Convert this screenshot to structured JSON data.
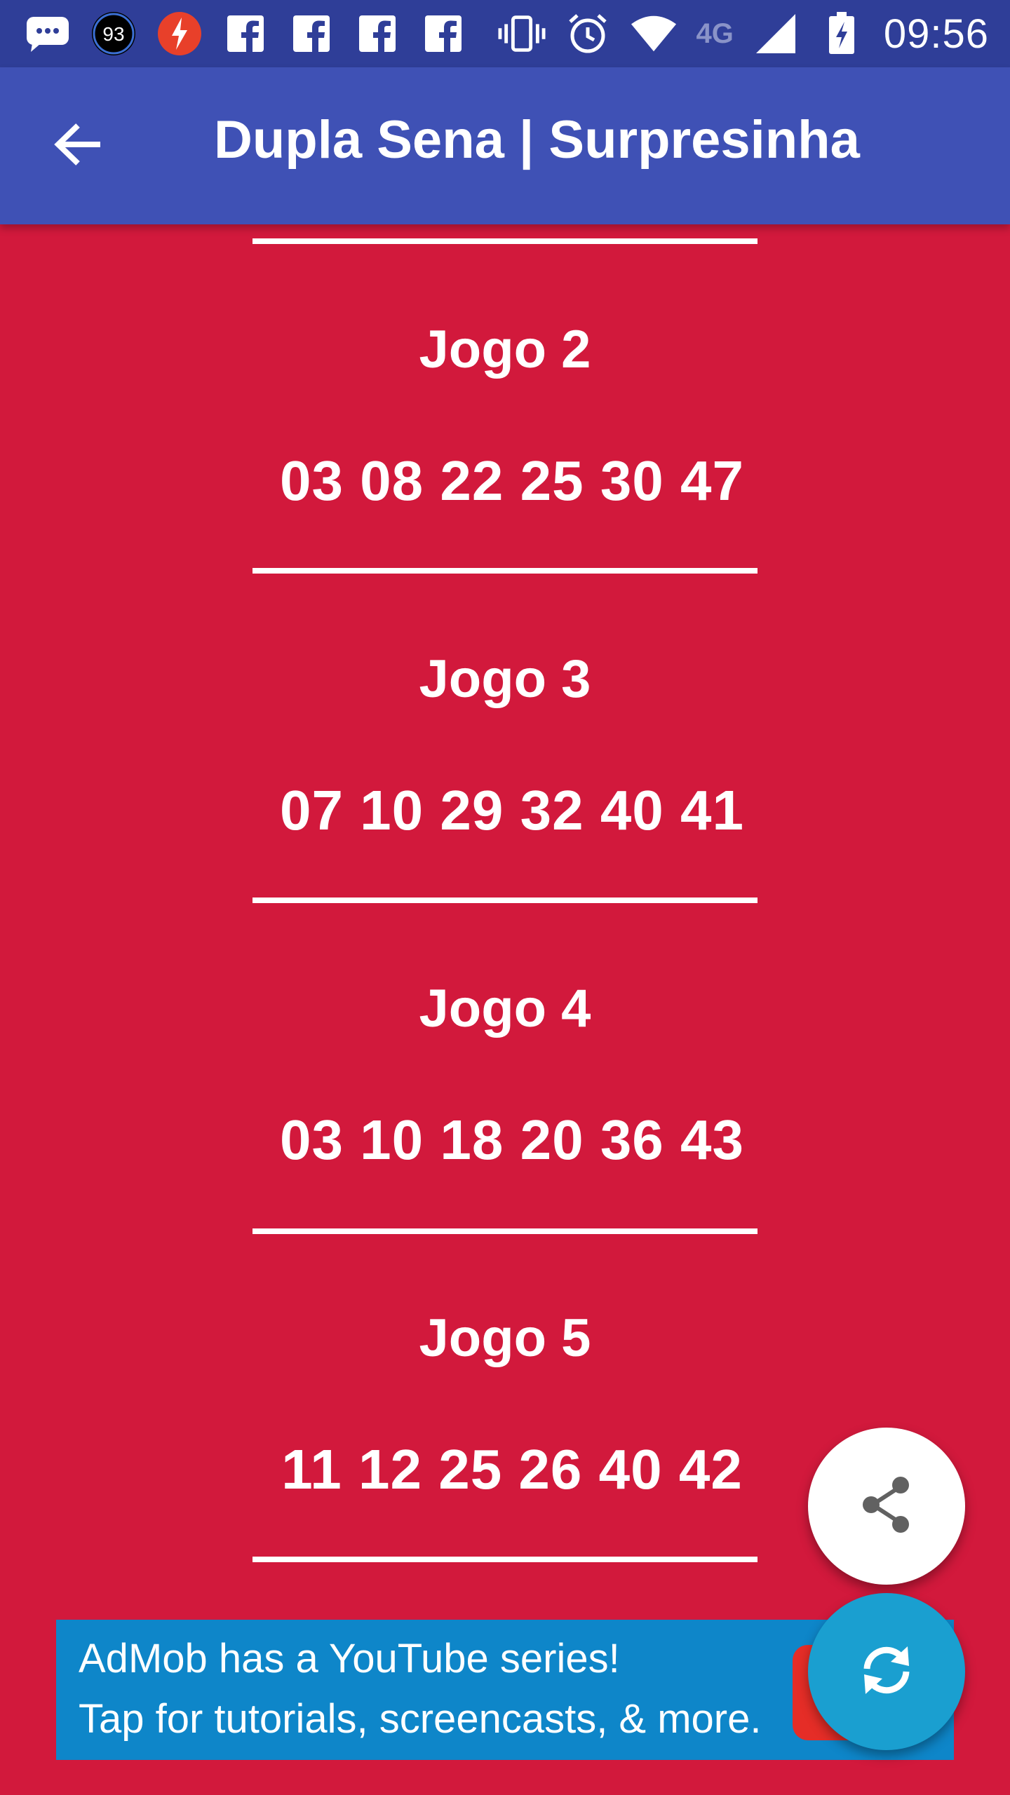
{
  "status_bar": {
    "badge_number": "93",
    "network": "4G",
    "time": "09:56"
  },
  "app_bar": {
    "title": "Dupla Sena | Surpresinha"
  },
  "games": [
    {
      "title": "Jogo 2",
      "numbers": "03 08 22 25 30 47"
    },
    {
      "title": "Jogo 3",
      "numbers": "07 10 29 32 40 41"
    },
    {
      "title": "Jogo 4",
      "numbers": "03 10 18 20 36 43"
    },
    {
      "title": "Jogo 5",
      "numbers": "11 12 25 26 40 42"
    }
  ],
  "ad": {
    "line1": "AdMob has a YouTube series!",
    "line2": "Tap for tutorials, screencasts, & more."
  },
  "colors": {
    "background": "#D2193C",
    "app_bar": "#3F51B5",
    "status_bar": "#2F3E98",
    "fab_refresh": "#1A9FD0",
    "ad_banner": "#0E86C9"
  }
}
